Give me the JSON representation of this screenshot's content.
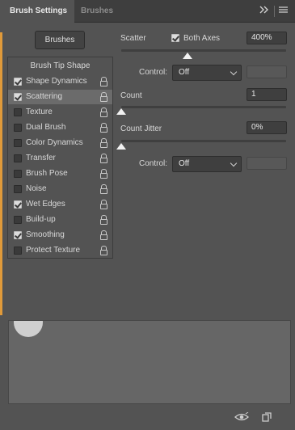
{
  "tabs": [
    {
      "label": "Brush Settings",
      "active": true
    },
    {
      "label": "Brushes",
      "active": false
    }
  ],
  "tabbar_icons": {
    "collapse": "double-chevron-right-icon",
    "menu": "hamburger-menu-icon"
  },
  "brushes_button": "Brushes",
  "tip_list": {
    "header": "Brush Tip Shape",
    "items": [
      {
        "label": "Shape Dynamics",
        "checked": true,
        "selected": false
      },
      {
        "label": "Scattering",
        "checked": true,
        "selected": true
      },
      {
        "label": "Texture",
        "checked": false,
        "selected": false
      },
      {
        "label": "Dual Brush",
        "checked": false,
        "selected": false
      },
      {
        "label": "Color Dynamics",
        "checked": false,
        "selected": false
      },
      {
        "label": "Transfer",
        "checked": false,
        "selected": false
      },
      {
        "label": "Brush Pose",
        "checked": false,
        "selected": false
      },
      {
        "label": "Noise",
        "checked": false,
        "selected": false
      },
      {
        "label": "Wet Edges",
        "checked": true,
        "selected": false
      },
      {
        "label": "Build-up",
        "checked": false,
        "selected": false
      },
      {
        "label": "Smoothing",
        "checked": true,
        "selected": false
      },
      {
        "label": "Protect Texture",
        "checked": false,
        "selected": false
      }
    ]
  },
  "scattering": {
    "scatter_label": "Scatter",
    "both_axes_label": "Both Axes",
    "both_axes_checked": true,
    "scatter_value": "400%",
    "scatter_control_label": "Control:",
    "scatter_control_value": "Off",
    "count_label": "Count",
    "count_value": "1",
    "count_jitter_label": "Count Jitter",
    "count_jitter_value": "0%",
    "jitter_control_label": "Control:",
    "jitter_control_value": "Off"
  },
  "bottom_icons": [
    "eye-toggle-icon",
    "new-preset-icon"
  ],
  "colors": {
    "panel": "#535353",
    "tabbar": "#3e3e3e",
    "accent_edge": "#e09a3a"
  }
}
